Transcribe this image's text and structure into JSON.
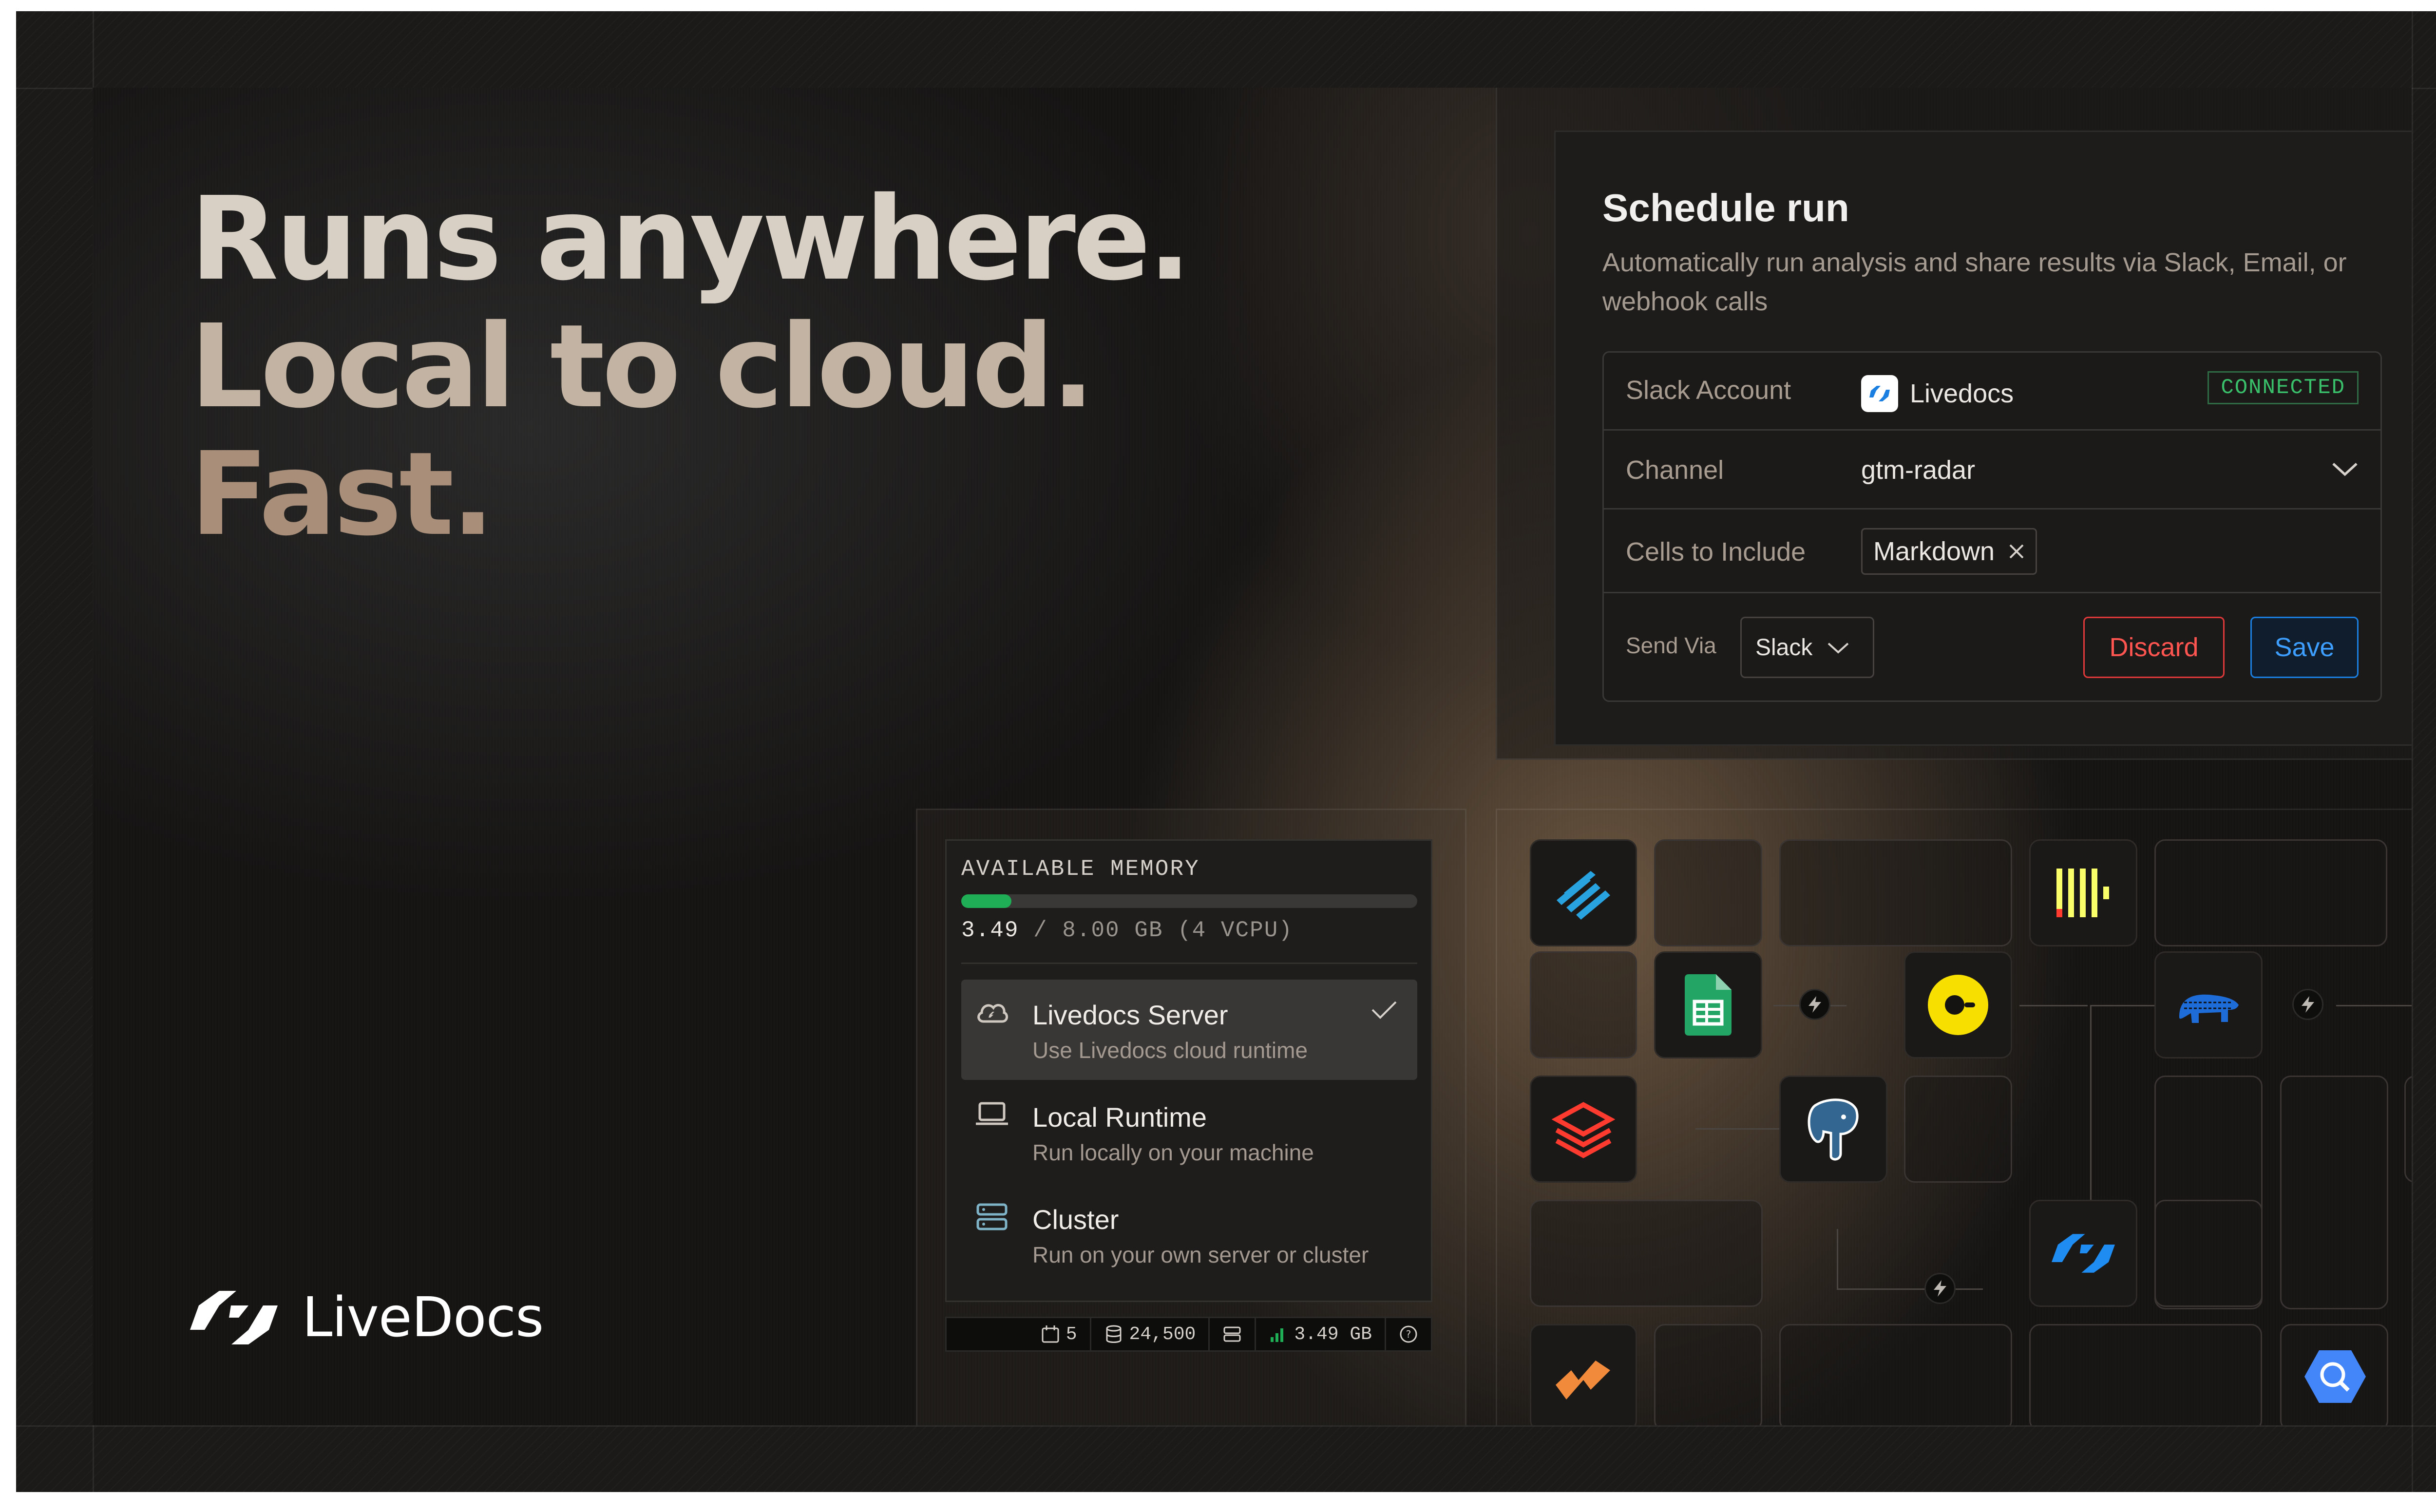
{
  "headline": {
    "line1": "Runs anywhere.",
    "line2": "Local to cloud.",
    "line3": "Fast."
  },
  "brand": {
    "name": "LiveDocs"
  },
  "schedule": {
    "title": "Schedule run",
    "description": "Automatically run analysis and share results via Slack, Email, or webhook calls",
    "slack_account": {
      "label": "Slack Account",
      "value": "Livedocs",
      "status": "CONNECTED"
    },
    "channel": {
      "label": "Channel",
      "value": "gtm-radar"
    },
    "cells": {
      "label": "Cells to Include",
      "chip": "Markdown"
    },
    "send_via": {
      "label": "Send Via",
      "value": "Slack"
    },
    "discard_label": "Discard",
    "save_label": "Save",
    "colors": {
      "connected": "#3ac06a",
      "discard": "#ff5550",
      "save": "#3d9eff"
    }
  },
  "memory": {
    "title": "AVAILABLE MEMORY",
    "used": "3.49",
    "total": "/ 8.00 GB (4 VCPU)",
    "fraction": 0.11,
    "bar_color": "#1fae55",
    "options": [
      {
        "title": "Livedocs Server",
        "subtitle": "Use Livedocs cloud runtime",
        "icon": "cloud-icon",
        "selected": true
      },
      {
        "title": "Local Runtime",
        "subtitle": "Run locally on your machine",
        "icon": "laptop-icon",
        "selected": false
      },
      {
        "title": "Cluster",
        "subtitle": "Run on your own server or cluster",
        "icon": "server-icon",
        "selected": false
      }
    ]
  },
  "statusbar": {
    "count": "5",
    "rows": "24,500",
    "memory": "3.49 GB"
  },
  "integrations": [
    "snowflake-icon",
    "clickhouse-icon",
    "google-sheets-icon",
    "posthog-icon",
    "duckdb-icon",
    "databricks-icon",
    "postgresql-icon",
    "livedocs-icon",
    "dbt-icon",
    "bigquery-icon"
  ]
}
